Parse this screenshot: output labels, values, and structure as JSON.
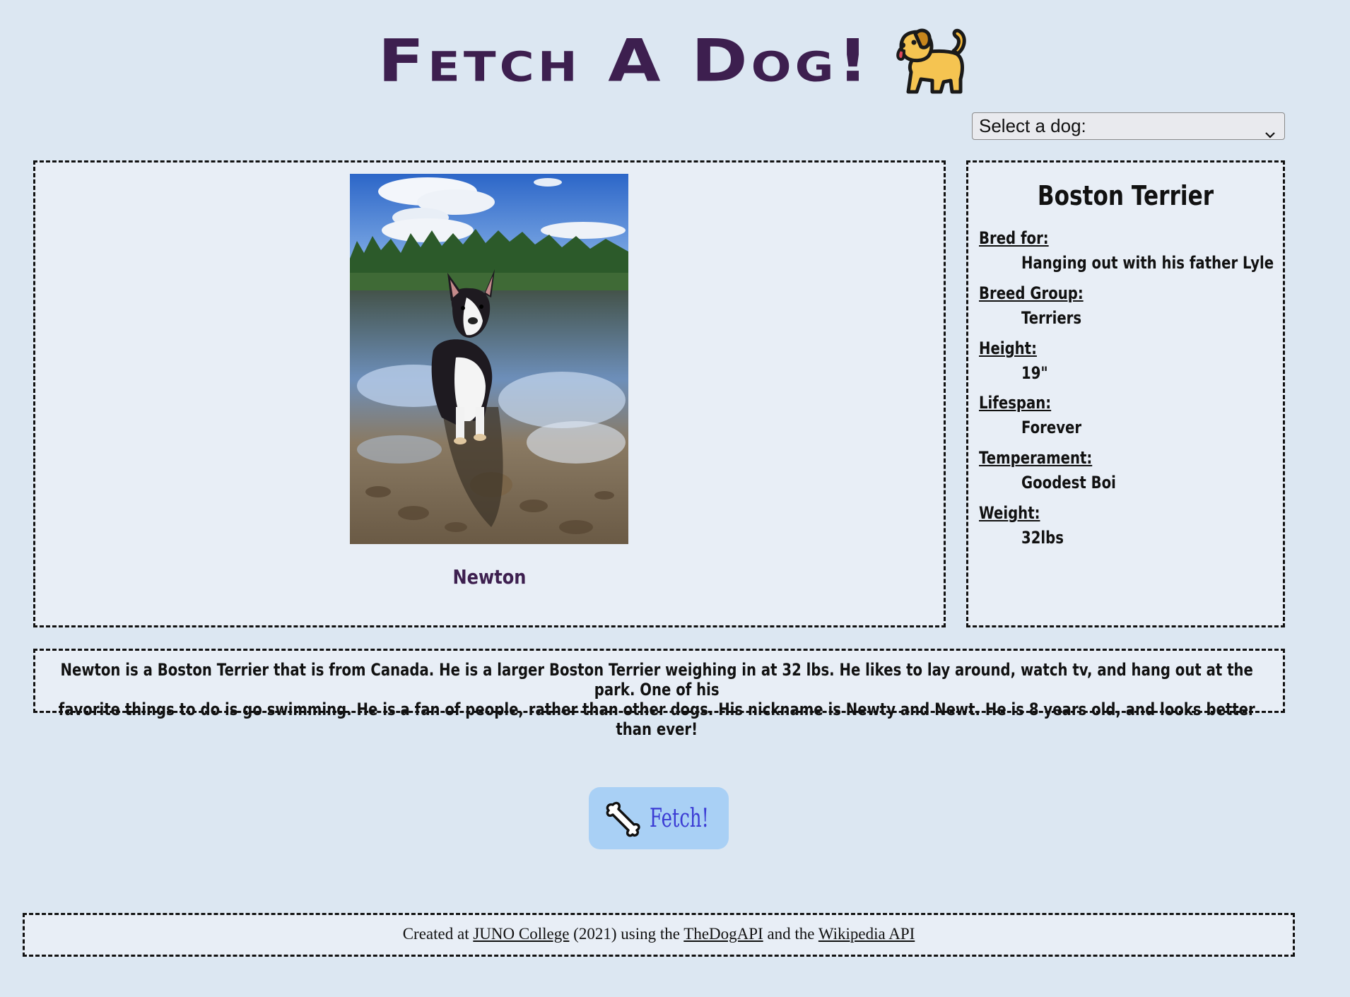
{
  "header": {
    "title": "Fetch A Dog!",
    "icon": "dog-icon"
  },
  "select": {
    "selected_label": "Select a dog:",
    "icon": "chevron-down-icon"
  },
  "dog": {
    "name": "Newton",
    "photo_icon": "dog-photo"
  },
  "info": {
    "breed": "Boston Terrier",
    "fields": [
      {
        "label": "Bred for:",
        "value": "Hanging out with his father Lyle"
      },
      {
        "label": "Breed Group:",
        "value": "Terriers"
      },
      {
        "label": "Height:",
        "value": "19\""
      },
      {
        "label": "Lifespan:",
        "value": "Forever"
      },
      {
        "label": "Temperament:",
        "value": "Goodest Boi"
      },
      {
        "label": "Weight:",
        "value": "32lbs"
      }
    ]
  },
  "description": {
    "line1": "Newton is a Boston Terrier that is from Canada. He is a larger Boston Terrier weighing in at 32 lbs. He likes to lay around, watch tv, and hang out at the park. One of his",
    "line2": "favorite things to do is go swimming. He is a fan of people, rather than other dogs. His nickname is Newty and Newt. He is 8 years old, and looks better than ever!"
  },
  "fetch_button": {
    "label": "Fetch!",
    "icon": "bone-icon"
  },
  "footer": {
    "prefix": "Created at ",
    "link1": "JUNO College",
    "middle1": " (2021) using the ",
    "link2": "TheDogAPI",
    "middle2": " and the ",
    "link3": "Wikipedia API"
  },
  "colors": {
    "background": "#dce7f2",
    "panel": "#e8eef6",
    "title": "#3d1f4f",
    "button": "#a9d0f5",
    "button_text": "#3b3bd4"
  }
}
